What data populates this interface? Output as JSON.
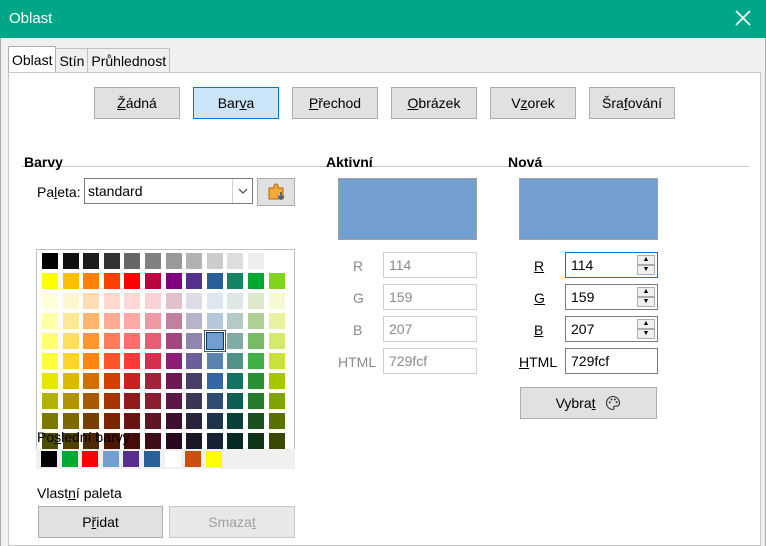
{
  "window": {
    "title": "Oblast"
  },
  "tabs": [
    "Oblast",
    "Stín",
    "Průhlednost"
  ],
  "fill_buttons": [
    {
      "label": "Žádná",
      "ul": "Ž",
      "rest": "ádná"
    },
    {
      "label": "Barva",
      "pre": "Bar",
      "ul": "v",
      "rest": "a"
    },
    {
      "label": "Přechod",
      "ul": "P",
      "rest": "řechod"
    },
    {
      "label": "Obrázek",
      "ul": "O",
      "rest": "brázek"
    },
    {
      "label": "Vzorek",
      "pre": "V",
      "ul": "z",
      "rest": "orek"
    },
    {
      "label": "Šrafování",
      "pre": "Šra",
      "ul": "f",
      "rest": "ování"
    }
  ],
  "colors": {
    "heading": "Barvy",
    "palette_label_pre": "Pa",
    "palette_label_ul": "l",
    "palette_label_rest": "eta:",
    "palette_value": "standard",
    "recent_label_pre": "Po",
    "recent_label_ul": "s",
    "recent_label_rest": "lední barvy",
    "custom_label_pre": "Vlast",
    "custom_label_ul": "n",
    "custom_label_rest": "í paleta",
    "add_pre": "P",
    "add_ul": "ř",
    "add_rest": "idat",
    "delete_pre": "Smaza",
    "delete_ul": "t",
    "delete_rest": ""
  },
  "active": {
    "heading": "Aktivní",
    "color": "#729fcf",
    "r_label": "R",
    "r": "114",
    "g_label": "G",
    "g": "159",
    "b_label": "B",
    "b": "207",
    "html_label": "HTML",
    "html": "729fcf"
  },
  "new": {
    "heading": "Nová",
    "color": "#729fcf",
    "r_label": "R",
    "r": "114",
    "g_label": "G",
    "g": "159",
    "b_label": "B",
    "b": "207",
    "html_label_ul": "H",
    "html_label_rest": "TML",
    "html": "729fcf",
    "pick_pre": "Vybra",
    "pick_ul": "t"
  },
  "palette_rows": [
    [
      "#000000",
      "#111111",
      "#1c1c1c",
      "#333333",
      "#666666",
      "#808080",
      "#999999",
      "#b2b2b2",
      "#cccccc",
      "#dddddd",
      "#eeeeee",
      "#ffffff"
    ],
    [
      "#ffff00",
      "#ffbf00",
      "#ff8000",
      "#ff4000",
      "#ff0000",
      "#bf0041",
      "#800080",
      "#55308d",
      "#2a6099",
      "#158466",
      "#00a933",
      "#81d41a"
    ],
    [
      "#ffffd7",
      "#fff5ce",
      "#ffdbb6",
      "#ffd8ce",
      "#ffd7d7",
      "#f7d1d5",
      "#e0c2cd",
      "#dedce6",
      "#dee6ef",
      "#dee7e5",
      "#dde8cb",
      "#f6f9d4"
    ],
    [
      "#ffffa6",
      "#ffe994",
      "#ffb66c",
      "#ffaa95",
      "#ffa6a6",
      "#ec9ba4",
      "#bf819e",
      "#b7b3ca",
      "#b4c7dc",
      "#b3cac7",
      "#afd095",
      "#e8f2a1"
    ],
    [
      "#ffff6d",
      "#ffde59",
      "#ff972f",
      "#ff7b59",
      "#ff6d6d",
      "#e16173",
      "#a1467e",
      "#8e86ae",
      "#729fcf",
      "#81aca6",
      "#77bc65",
      "#d4ea6b"
    ],
    [
      "#ffff38",
      "#ffd428",
      "#ff860d",
      "#ff5429",
      "#ff3838",
      "#d62e4e",
      "#8d1d75",
      "#6b5e9b",
      "#5983b0",
      "#50938a",
      "#3faf46",
      "#c9e138"
    ],
    [
      "#e6e600",
      "#dcb900",
      "#d26f00",
      "#d24100",
      "#c9211e",
      "#a1233b",
      "#6d1a52",
      "#483e6a",
      "#3465a4",
      "#127362",
      "#2a9034",
      "#a6c700"
    ],
    [
      "#b2b200",
      "#b39200",
      "#a85a00",
      "#a83400",
      "#941b1b",
      "#8a1f32",
      "#5b1745",
      "#3d3556",
      "#2f4d74",
      "#0f5e52",
      "#237b2c",
      "#7fa300"
    ],
    [
      "#7a7a00",
      "#7f6800",
      "#784000",
      "#7b2400",
      "#6b1212",
      "#5e1524",
      "#3d0f30",
      "#29233c",
      "#1e334c",
      "#094039",
      "#1b5121",
      "#587100"
    ],
    [
      "#4d4d00",
      "#4f4000",
      "#4d2800",
      "#4d1600",
      "#480c0c",
      "#3e0d19",
      "#270a1f",
      "#1b1726",
      "#142233",
      "#042b26",
      "#113417",
      "#394a00"
    ]
  ],
  "recent_colors": [
    "#000000",
    "#00a933",
    "#ff0000",
    "#729fcf",
    "#55308d",
    "#2a6099",
    "#ffffff",
    "#c9500f",
    "#ffff00"
  ],
  "selected_swatch": "#729fcf"
}
